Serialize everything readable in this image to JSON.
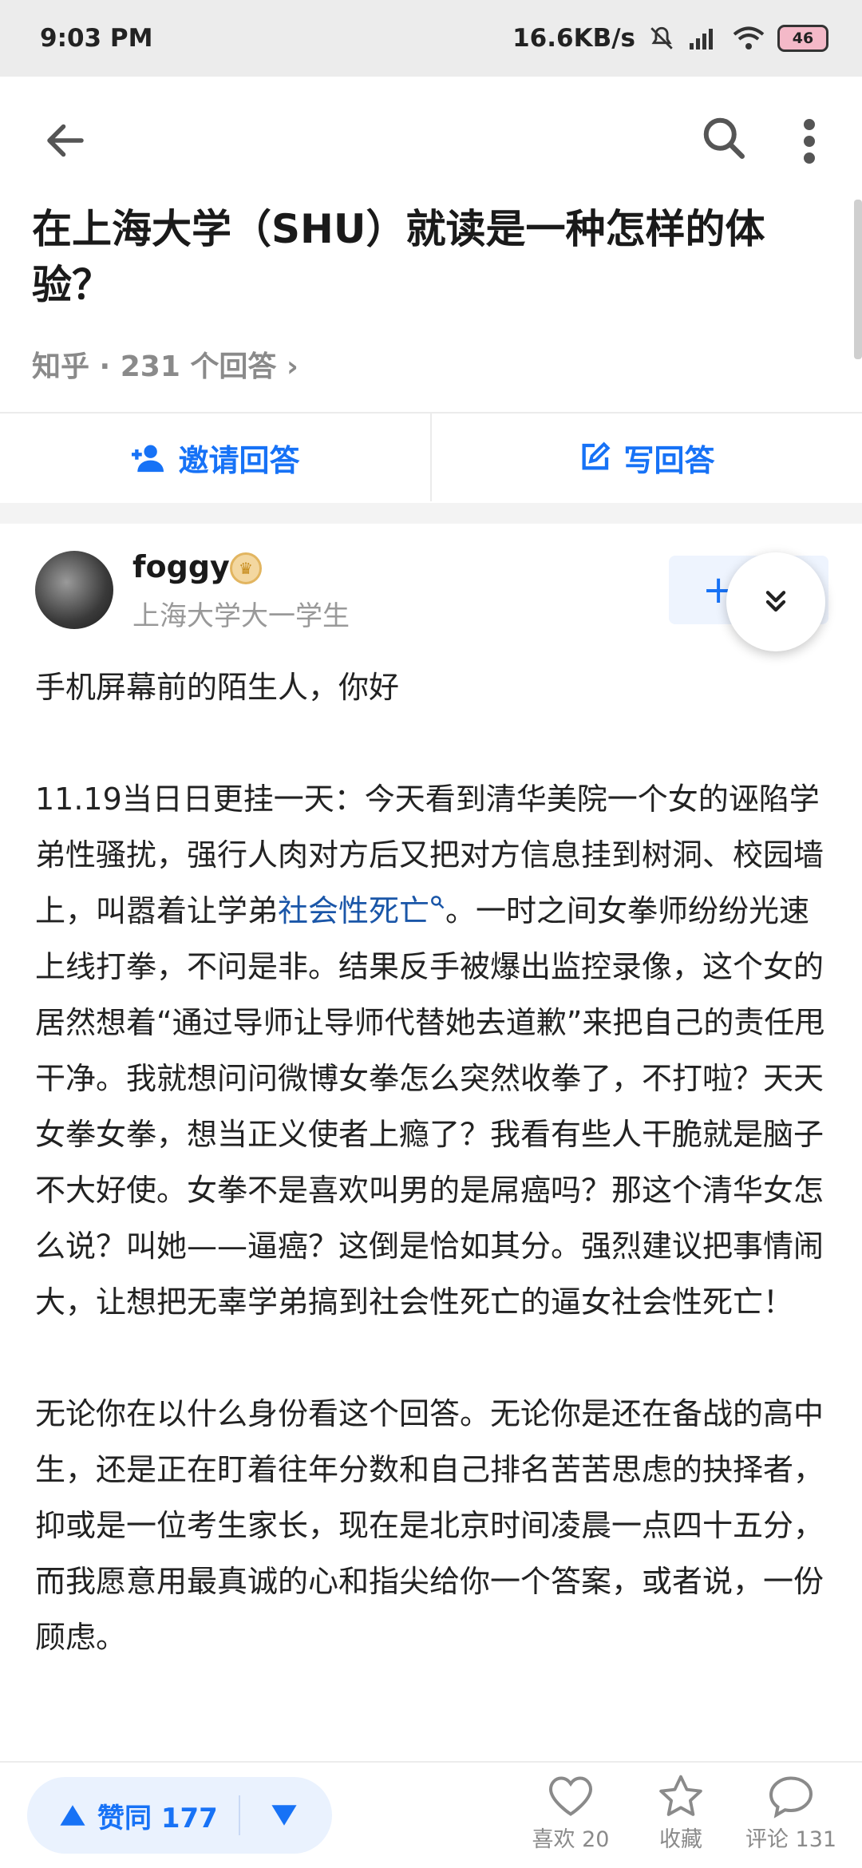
{
  "status_bar": {
    "time": "9:03 PM",
    "net_speed": "16.6KB/s",
    "battery": "46"
  },
  "question": {
    "title": "在上海大学（SHU）就读是一种怎样的体验？",
    "source": "知乎",
    "answer_count": "231 个回答",
    "meta": "知乎 · 231 个回答 ›"
  },
  "actions": {
    "invite_label": "邀请回答",
    "write_label": "写回答"
  },
  "answer": {
    "author_name": "foggy",
    "author_desc": "上海大学大一学生",
    "follow_label": "+",
    "paragraphs": [
      "手机屏幕前的陌生人，你好",
      "11.19当日日更挂一天：今天看到清华美院一个女的诬陷学弟性骚扰，强行人肉对方后又把对方信息挂到树洞、校园墙上，叫嚣着让学弟",
      "。一时之间女拳师纷纷光速上线打拳，不问是非。结果反手被爆出监控录像，这个女的居然想着“通过导师让导师代替她去道歉”来把自己的责任甩干净。我就想问问微博女拳怎么突然收拳了，不打啦？天天女拳女拳，想当正义使者上瘾了？我看有些人干脆就是脑子不大好使。女拳不是喜欢叫男的是屌癌吗？那这个清华女怎么说？叫她——逼癌？这倒是恰如其分。强烈建议把事情闹大，让想把无辜学弟搞到社会性死亡的逼女社会性死亡！",
      "无论你在以什么身份看这个回答。无论你是还在备战的高中生，还是正在盯着往年分数和自己排名苦苦思虑的抉择者，抑或是一位考生家长，现在是北京时间凌晨一点四十五分，而我愿意用最真诚的心和指尖给你一个答案，或者说，一份顾虑。"
    ],
    "link_text": "社会性死亡"
  },
  "bottom_bar": {
    "vote_label": "赞同 177",
    "like_label": "喜欢 20",
    "collect_label": "收藏",
    "comment_label": "评论 131"
  },
  "colors": {
    "accent": "#1772f6",
    "link": "#1a56a8",
    "muted": "#8a8a8a"
  }
}
